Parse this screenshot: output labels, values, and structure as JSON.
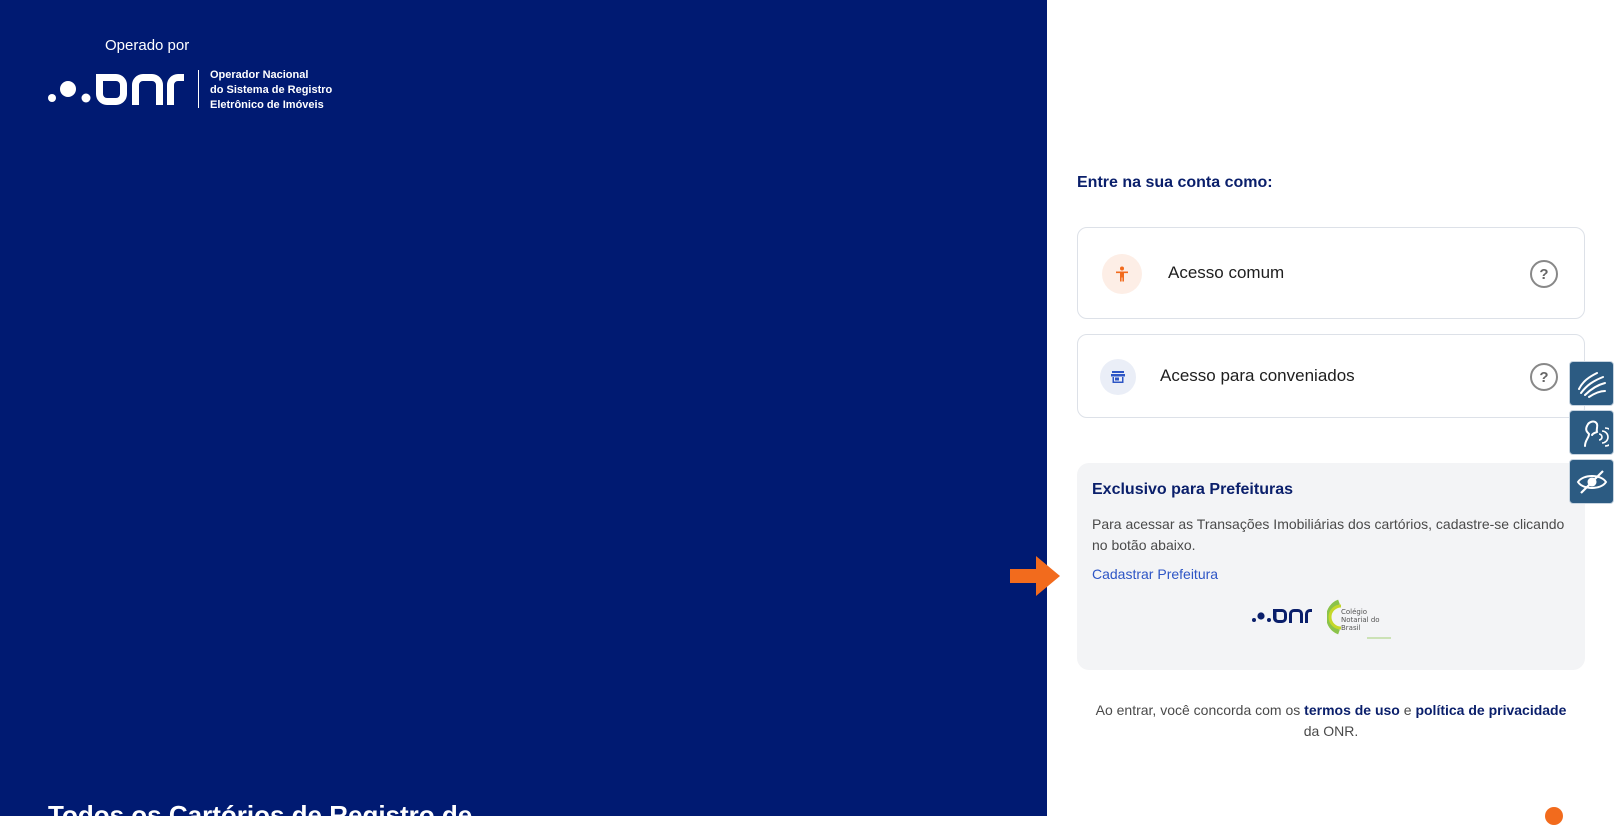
{
  "brand": {
    "operated_by": "Operado por",
    "logo_text": "onr",
    "caption": [
      "Operador Nacional",
      "do Sistema de Registro",
      "Eletrônico de Imóveis"
    ],
    "bottom_headline": "Todos os Cartórios de Registro de"
  },
  "login": {
    "title": "Entre na sua conta como:",
    "options": [
      {
        "label": "Acesso comum",
        "icon": "person-icon",
        "help": "?"
      },
      {
        "label": "Acesso para conveniados",
        "icon": "store-icon",
        "help": "?"
      }
    ]
  },
  "prefeituras": {
    "title": "Exclusivo para Prefeituras",
    "description": "Para acessar as Transações Imobiliárias dos cartórios, cadastre-se clicando no botão abaixo.",
    "link_label": "Cadastrar Prefeitura",
    "cnb_logo_lines": [
      "Colégio",
      "Notarial do",
      "Brasil"
    ]
  },
  "terms": {
    "prefix": "Ao entrar, você concorda com os",
    "terms_link": "termos de uso",
    "conjunction": "e",
    "privacy_link": "política de privacidade",
    "suffix": "da ONR."
  },
  "accessibility": [
    "sign-language-icon",
    "audio-reader-icon",
    "high-contrast-icon"
  ],
  "colors": {
    "left_panel": "#001a72",
    "accent_orange": "#f26b1d",
    "link_blue": "#2d55c5",
    "title_navy": "#0a1f6b",
    "a11y_button": "#2c5b82"
  }
}
